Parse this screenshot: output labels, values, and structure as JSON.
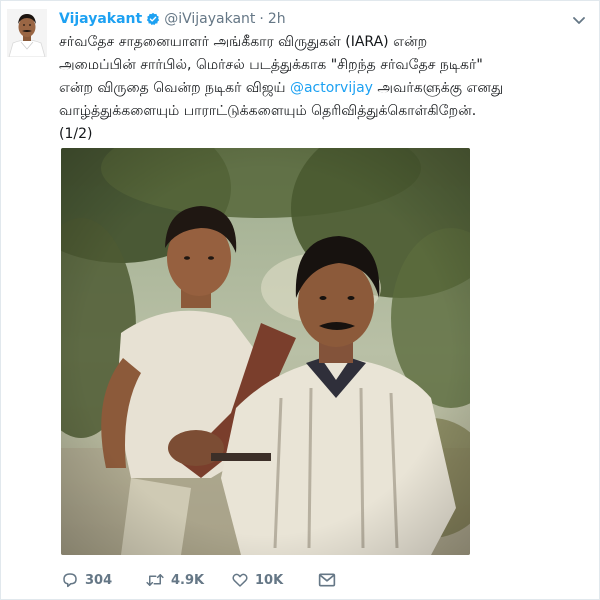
{
  "tweet": {
    "author": {
      "name": "Vijayakant",
      "handle": "@iVijayakant",
      "verified": true
    },
    "separator": "·",
    "time": "2h",
    "text": {
      "line1": "சர்வதேச சாதனையாளர் அங்கீகார விருதுகள் (IARA) என்ற",
      "line2": "அமைப்பின் சார்பில், மெர்சல் படத்துக்காக \"சிறந்த சர்வதேச நடிகர்\"",
      "line3_pre": "என்ற விருதை வென்ற நடிகர் விஜய் ",
      "line3_mention": "@actorvijay",
      "line3_post": " அவர்களுக்கு எனது",
      "line4": "வாழ்த்துக்களையும் பாராட்டுக்களையும் தெரிவித்துக்கொள்கிறேன்.",
      "line5": "(1/2)"
    },
    "actions": {
      "replies": "304",
      "retweets": "4.9K",
      "likes": "10K"
    },
    "colors": {
      "accent": "#1da1f2",
      "muted": "#657786",
      "text": "#14171a"
    }
  }
}
